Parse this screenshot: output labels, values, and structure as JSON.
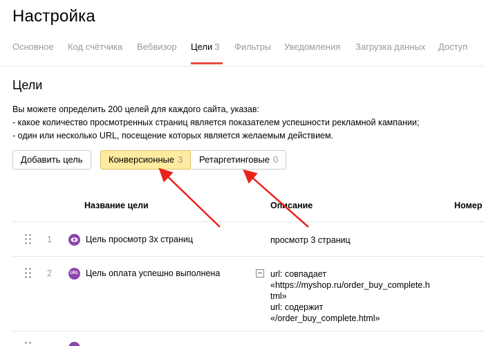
{
  "page": {
    "title": "Настройка"
  },
  "tabs": [
    {
      "label": "Основное"
    },
    {
      "label": "Код счётчика"
    },
    {
      "label": "Вебвизор"
    },
    {
      "label": "Цели",
      "count": "3"
    },
    {
      "label": "Фильтры"
    },
    {
      "label": "Уведомления"
    },
    {
      "label": "Загрузка данных"
    },
    {
      "label": "Доступ"
    }
  ],
  "section": {
    "title": "Цели",
    "desc_lines": [
      "Вы можете определить 200 целей для каждого сайта, указав:",
      "- какое количество просмотренных страниц является показателем успешности рекламной кампании;",
      "- один или несколько URL, посещение которых является желаемым действием."
    ]
  },
  "toolbar": {
    "add_label": "Добавить цель",
    "conv_label": "Конверсионные",
    "conv_count": "3",
    "retarg_label": "Ретаргетинговые",
    "retarg_count": "0"
  },
  "table": {
    "headers": {
      "name": "Название цели",
      "desc": "Описание",
      "num": "Номер"
    },
    "rows": [
      {
        "num": "1",
        "icon": "eye-icon",
        "name": "Цель просмотр 3х страниц",
        "desc_lines": [
          "просмотр 3 страниц"
        ]
      },
      {
        "num": "2",
        "icon": "url-icon",
        "icon_text": "URL",
        "name": "Цель оплата успешно выполнена",
        "desc_lines": [
          "url: совпадает",
          "«https://myshop.ru/order_buy_complete.h",
          "tml»",
          "url: содержит",
          "«/order_buy_complete.html»"
        ]
      }
    ]
  },
  "colors": {
    "accent_red": "#e74c3c",
    "segment_active": "#ffeba0",
    "goal_icon": "#8e44ad",
    "arrow": "#e8231c"
  }
}
